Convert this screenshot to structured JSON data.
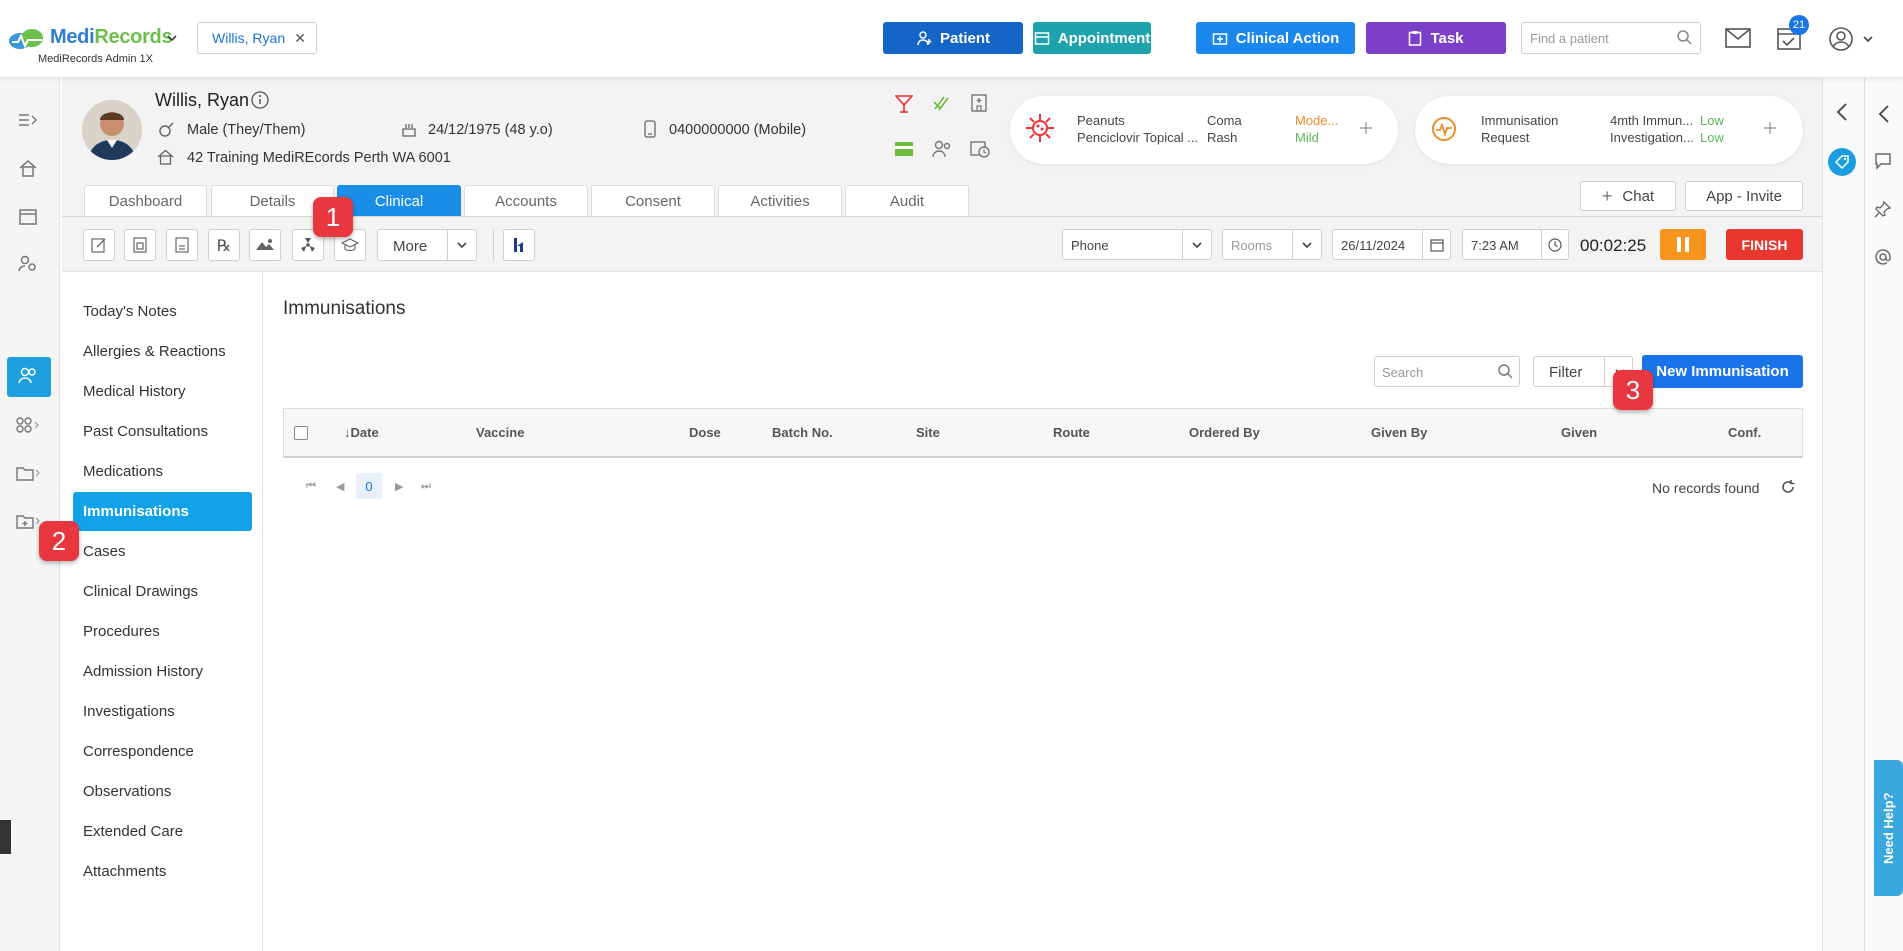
{
  "app": {
    "logo": "MediRecords",
    "subtitle": "MediRecords Admin 1X",
    "open_patient_tab": "Willis, Ryan"
  },
  "topbar": {
    "patient_btn": "Patient",
    "appointment_btn": "Appointment",
    "clinical_action_btn": "Clinical Action",
    "task_btn": "Task",
    "find_placeholder": "Find a patient",
    "task_count": "21"
  },
  "patient": {
    "name": "Willis, Ryan",
    "gender": "Male (They/Them)",
    "dob": "24/12/1975 (48 y.o)",
    "phone": "0400000000 (Mobile)",
    "address": "42 Training MediREcords Perth WA 6001"
  },
  "allergy_card": {
    "allergen1": "Peanuts",
    "allergen2": "Penciclovir Topical ...",
    "reaction1": "Coma",
    "reaction2": "Rash",
    "severity1": "Mode...",
    "severity2": "Mild",
    "severity1_color": "#f08c2a",
    "severity2_color": "#5cb85c"
  },
  "reminder_card": {
    "title1": "Immunisation",
    "title2": "Request",
    "item1": "4mth Immun...",
    "item2": "Investigation...",
    "level1": "Low",
    "level2": "Low"
  },
  "actions": {
    "chat": "Chat",
    "app_invite": "App - Invite"
  },
  "tabs": [
    "Dashboard",
    "Details",
    "Clinical",
    "Accounts",
    "Consent",
    "Activities",
    "Audit"
  ],
  "toolbar": {
    "more": "More",
    "mode": "Phone",
    "rooms": "Rooms",
    "date": "26/11/2024",
    "time": "7:23 AM",
    "timer": "00:02:25",
    "finish": "FINISH"
  },
  "sidebar": {
    "items": [
      "Today's Notes",
      "Allergies & Reactions",
      "Medical History",
      "Past Consultations",
      "Medications",
      "Immunisations",
      "Cases",
      "Clinical Drawings",
      "Procedures",
      "Admission History",
      "Investigations",
      "Correspondence",
      "Observations",
      "Extended Care",
      "Attachments"
    ]
  },
  "content": {
    "title": "Immunisations",
    "search_placeholder": "Search",
    "filter": "Filter",
    "new_btn": "New Immunisation",
    "columns": [
      "↓Date",
      "Vaccine",
      "Dose",
      "Batch No.",
      "Site",
      "Route",
      "Ordered By",
      "Given By",
      "Given",
      "Conf."
    ],
    "page": "0",
    "empty": "No records found"
  },
  "annotations": [
    "1",
    "2",
    "3"
  ],
  "help": "Need Help?"
}
